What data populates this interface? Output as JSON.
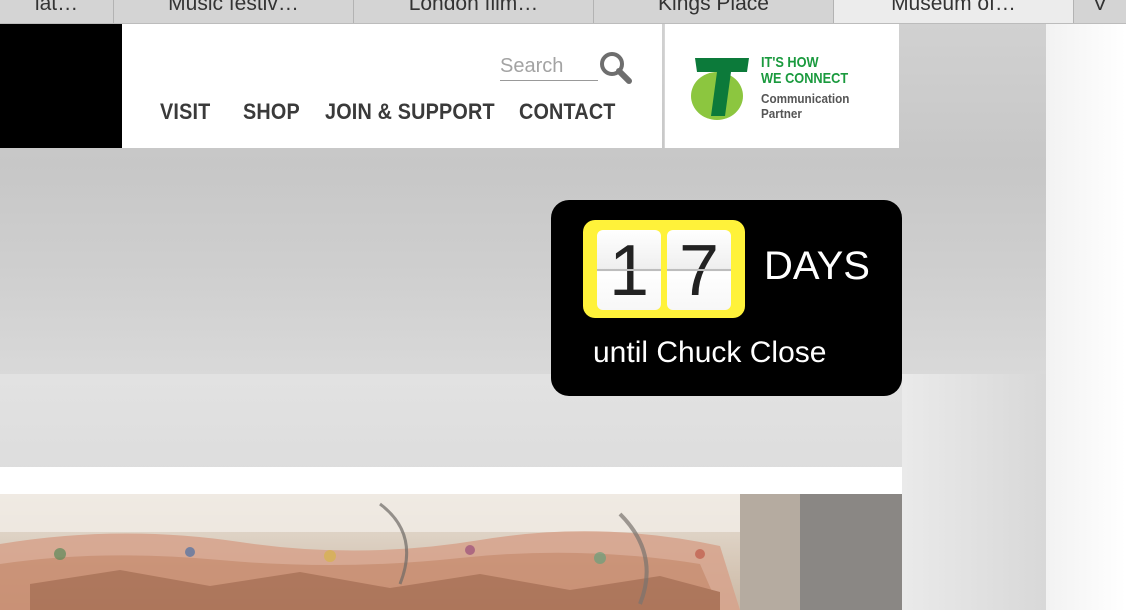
{
  "browser_tabs": [
    {
      "label": "lat…",
      "active": false
    },
    {
      "label": "Music festiv…",
      "active": false
    },
    {
      "label": "London film…",
      "active": false
    },
    {
      "label": "Kings Place",
      "active": false
    },
    {
      "label": "Museum of…",
      "active": true
    },
    {
      "label": "V",
      "active": false
    }
  ],
  "search": {
    "placeholder": "Search",
    "icon": "search-icon"
  },
  "nav": {
    "items": [
      "VISIT",
      "SHOP",
      "JOIN & SUPPORT",
      "CONTACT"
    ]
  },
  "partner": {
    "tagline_line1": "IT'S HOW",
    "tagline_line2": "WE CONNECT",
    "role_line1": "Communication",
    "role_line2": "Partner",
    "logo_icon": "telstra-logo",
    "brand_color": "#1a9a3e",
    "logo_color": "#8cc63f"
  },
  "countdown": {
    "digits": [
      "1",
      "7"
    ],
    "unit": "DAYS",
    "caption": "until Chuck Close",
    "highlight_color": "#fff23a"
  }
}
